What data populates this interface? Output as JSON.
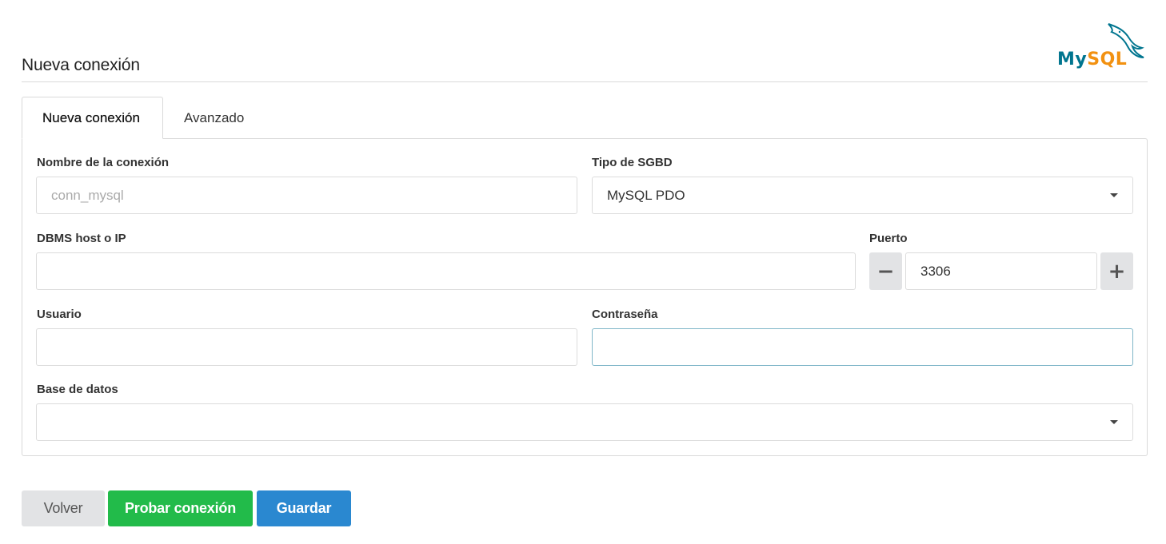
{
  "page": {
    "title": "Nueva conexión"
  },
  "logo": {
    "text_my": "My",
    "text_sql": "SQL",
    "icon": "mysql-dolphin-icon"
  },
  "tabs": [
    {
      "label": "Nueva conexión",
      "active": true
    },
    {
      "label": "Avanzado",
      "active": false
    }
  ],
  "form": {
    "connection_name": {
      "label": "Nombre de la conexión",
      "value": "",
      "placeholder": "conn_mysql"
    },
    "dbms_type": {
      "label": "Tipo de SGBD",
      "value": "MySQL PDO"
    },
    "host": {
      "label": "DBMS host o IP",
      "value": ""
    },
    "port": {
      "label": "Puerto",
      "value": "3306",
      "minus": "−",
      "plus": "+"
    },
    "user": {
      "label": "Usuario",
      "value": ""
    },
    "password": {
      "label": "Contraseña",
      "value": ""
    },
    "database": {
      "label": "Base de datos",
      "value": ""
    }
  },
  "buttons": {
    "back": "Volver",
    "test": "Probar conexión",
    "save": "Guardar"
  },
  "colors": {
    "mysql_blue": "#00758f",
    "mysql_orange": "#f29111",
    "success": "#22bb4a",
    "primary": "#2a88d0",
    "secondary": "#e2e3e5"
  }
}
